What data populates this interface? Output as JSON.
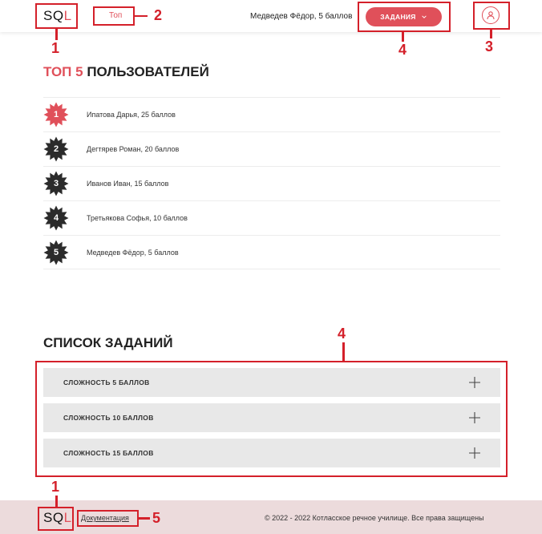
{
  "header": {
    "logo_sq": "SQ",
    "logo_l": "L",
    "nav_top": "Топ",
    "username": "Медведев Фёдор, 5 баллов",
    "tasks_button": "ЗАДАНИЯ"
  },
  "top": {
    "title_accent": "ТОП 5",
    "title_rest": "ПОЛЬЗОВАТЕЛЕЙ",
    "rows": [
      {
        "rank": "1",
        "text": "Ипатова Дарья, 25 баллов"
      },
      {
        "rank": "2",
        "text": "Дегтярев Роман, 20 баллов"
      },
      {
        "rank": "3",
        "text": "Иванов Иван, 15 баллов"
      },
      {
        "rank": "4",
        "text": "Третьякова Софья, 10 баллов"
      },
      {
        "rank": "5",
        "text": "Медведев Фёдор, 5 баллов"
      }
    ]
  },
  "tasks": {
    "title": "СПИСОК ЗАДАНИЙ",
    "items": [
      {
        "label": "СЛОЖНОСТЬ 5 БАЛЛОВ"
      },
      {
        "label": "СЛОЖНОСТЬ 10 БАЛЛОВ"
      },
      {
        "label": "СЛОЖНОСТЬ 15 БАЛЛОВ"
      }
    ]
  },
  "footer": {
    "logo_sq": "SQ",
    "logo_l": "L",
    "doc_link": "Документация",
    "copyright": "© 2022 - 2022 Котласское речное училище. Все права защищены"
  },
  "callouts": {
    "c1a": "1",
    "c2": "2",
    "c3": "3",
    "c4a": "4",
    "c4b": "4",
    "c1b": "1",
    "c5": "5"
  },
  "colors": {
    "accent": "#e0505a",
    "callout": "#d4202a",
    "badge_dark": "#2b2b2b",
    "footer_bg": "#ecdbdc",
    "accordion_bg": "#e8e8e8"
  }
}
